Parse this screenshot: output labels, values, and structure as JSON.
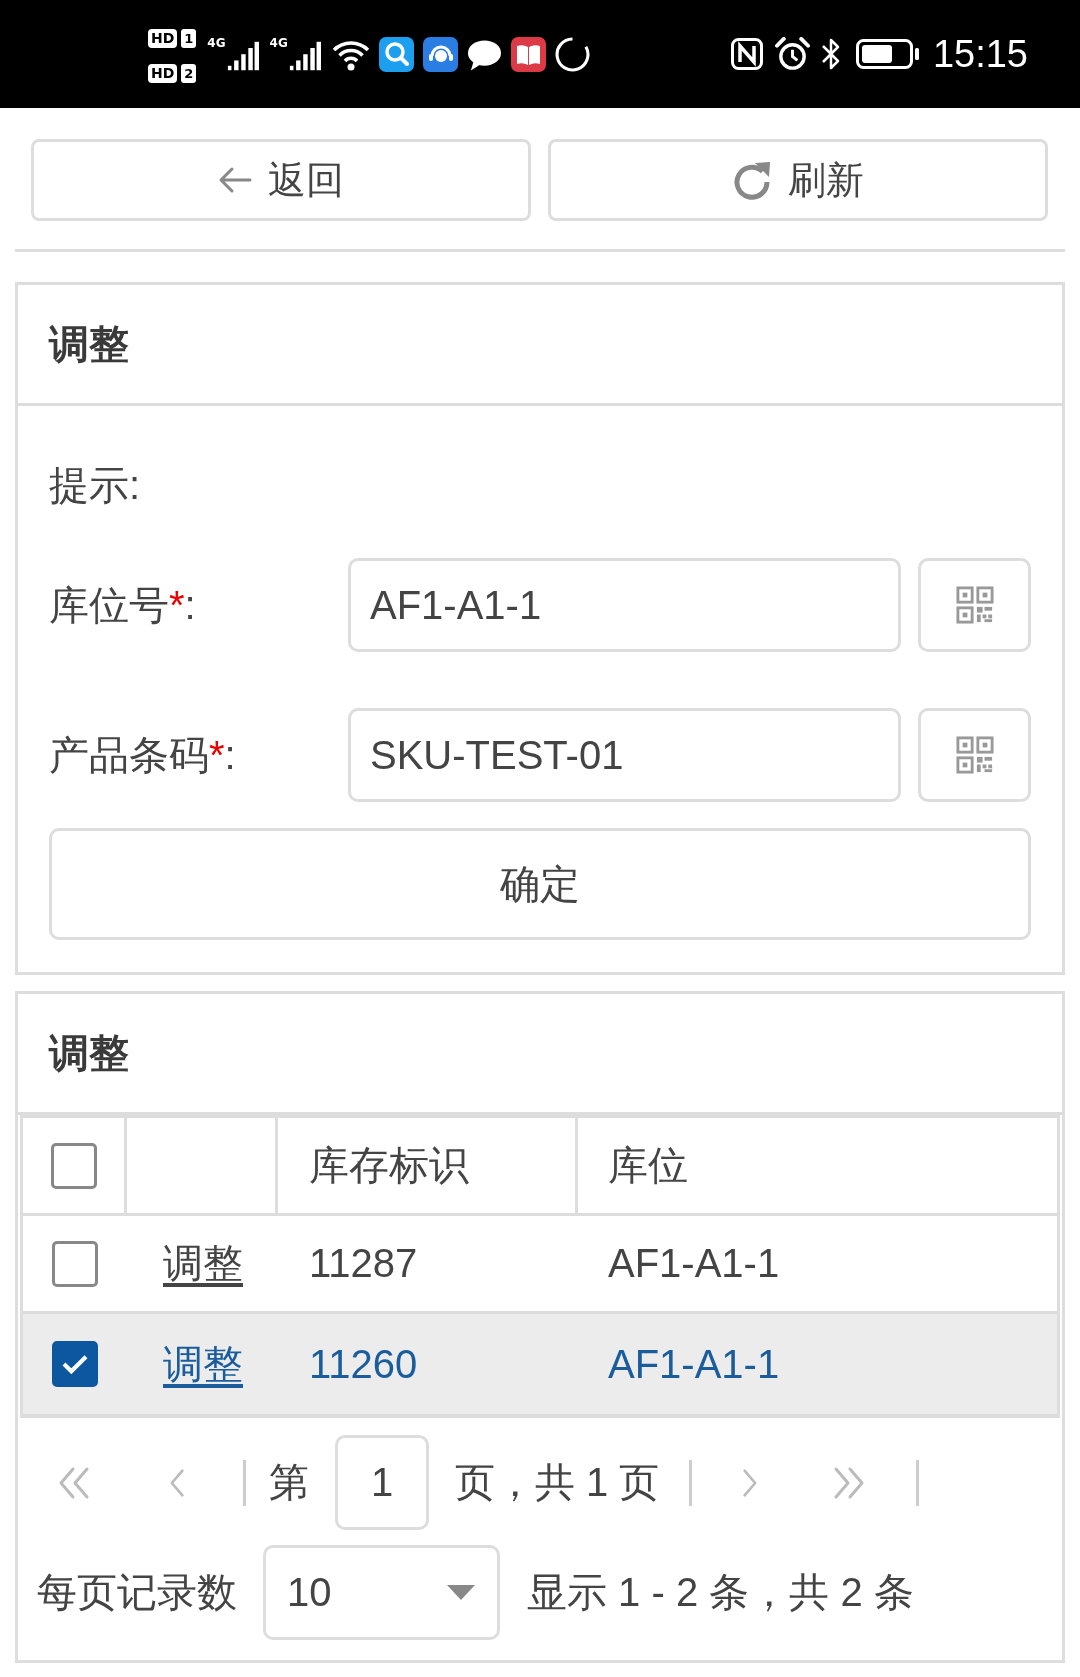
{
  "status_bar": {
    "sims": [
      {
        "badge": "HD",
        "slot": "1"
      },
      {
        "badge": "HD",
        "slot": "2"
      }
    ],
    "networks": [
      {
        "type": "4G"
      },
      {
        "type": "4G"
      }
    ],
    "time": "15:15"
  },
  "toolbar": {
    "buttons": [
      {
        "kind": "back",
        "label": "返回"
      },
      {
        "kind": "refresh",
        "label": "刷新"
      }
    ]
  },
  "form_panel": {
    "title": "调整",
    "hint_label": "提示:",
    "fields": [
      {
        "label": "库位号",
        "required_mark": "*",
        "suffix": ":",
        "value": "AF1-A1-1"
      },
      {
        "label": "产品条码",
        "required_mark": "*",
        "suffix": ":",
        "value": "SKU-TEST-01"
      }
    ],
    "submit_label": "确定"
  },
  "results_panel": {
    "title": "调整",
    "table": {
      "select_all_checked": false,
      "columns": [
        {
          "label": "库存标识"
        },
        {
          "label": "库位"
        }
      ],
      "rows": [
        {
          "selected": false,
          "action": "调整",
          "stock_id": "11287",
          "location": "AF1-A1-1"
        },
        {
          "selected": true,
          "action": "调整",
          "stock_id": "11260",
          "location": "AF1-A1-1"
        }
      ]
    },
    "pagination": {
      "nav_back": [
        {
          "kind": "first",
          "disabled": true
        },
        {
          "kind": "prev",
          "disabled": true
        }
      ],
      "page_prefix": "第",
      "page_value": "1",
      "page_suffix": "页，共 1 页",
      "nav_forward": [
        {
          "kind": "next",
          "disabled": true
        },
        {
          "kind": "last",
          "disabled": true
        }
      ],
      "page_size_label": "每页记录数",
      "page_size": "10",
      "summary": "显示 1 - 2 条，共 2 条"
    }
  }
}
